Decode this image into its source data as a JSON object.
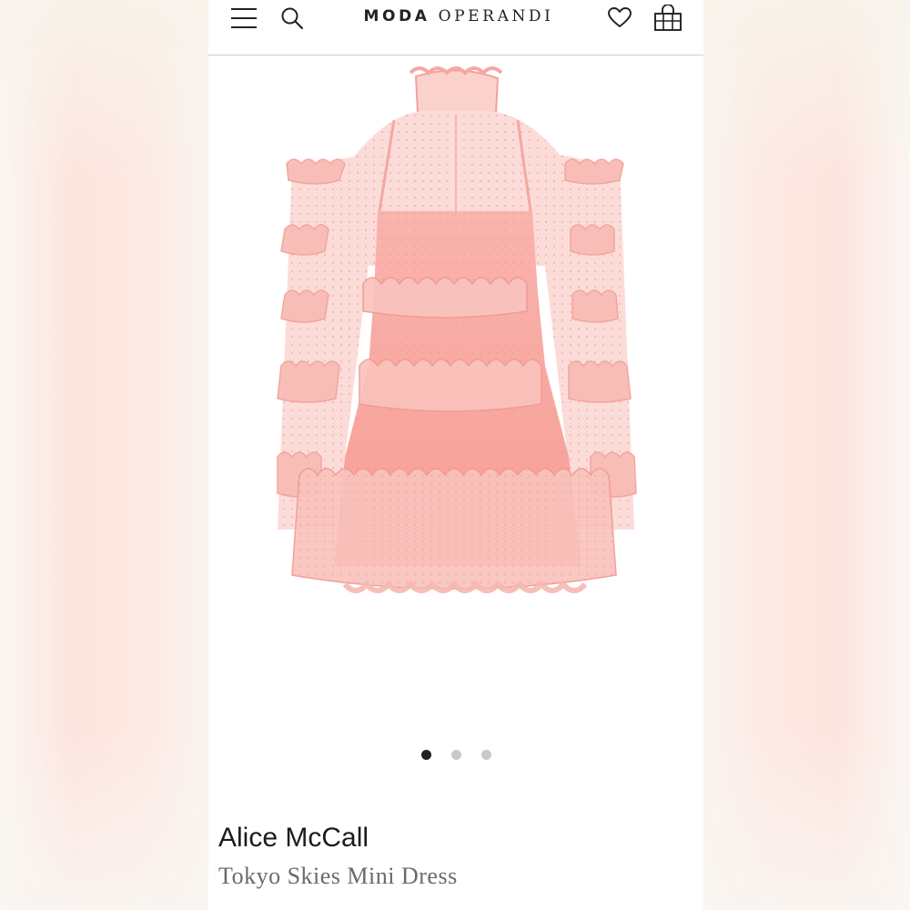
{
  "header": {
    "logo_word_1": "MODA",
    "logo_word_2": "OPERANDI",
    "icons": [
      "menu-icon",
      "search-icon",
      "heart-icon",
      "shopping-bag-icon"
    ]
  },
  "gallery": {
    "image_subject": "Pink ruffled tulle mini dress",
    "slide_count": 3,
    "active_slide": 1
  },
  "product": {
    "brand": "Alice McCall",
    "name": "Tokyo Skies Mini Dress"
  },
  "colors": {
    "dress": "#f8a6a0",
    "text_dark": "#1c1c1c",
    "text_muted": "#6a6a6a"
  }
}
